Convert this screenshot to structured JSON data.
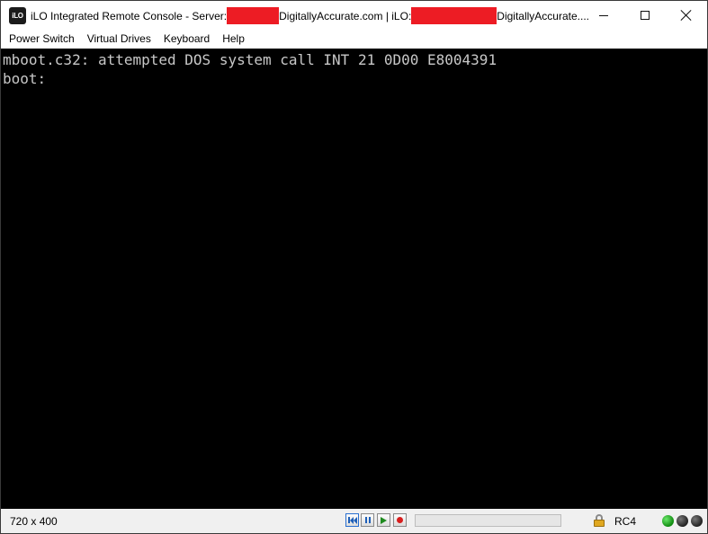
{
  "window": {
    "icon_text": "iLO",
    "title_prefix": "iLO Integrated Remote Console - Server:",
    "title_server_suffix": "DigitallyAccurate.com | iLO:",
    "title_ilo_suffix": "DigitallyAccurate....",
    "redaction_color": "#ed1c24"
  },
  "menu": [
    {
      "label": "Power Switch"
    },
    {
      "label": "Virtual Drives"
    },
    {
      "label": "Keyboard"
    },
    {
      "label": "Help"
    }
  ],
  "console": {
    "lines": [
      "mboot.c32: attempted DOS system call INT 21 0D00 E8004391",
      "boot:"
    ],
    "background": "#000000",
    "text_color": "#c8c8c8"
  },
  "status": {
    "resolution": "720 x 400",
    "encryption": "RC4",
    "playback_controls": [
      "rewind-icon",
      "pause-icon",
      "play-icon",
      "record-icon"
    ],
    "leds": [
      {
        "name": "led-green",
        "color": "#1aa31a"
      },
      {
        "name": "led-dark-1",
        "color": "#333333"
      },
      {
        "name": "led-dark-2",
        "color": "#333333"
      }
    ]
  }
}
